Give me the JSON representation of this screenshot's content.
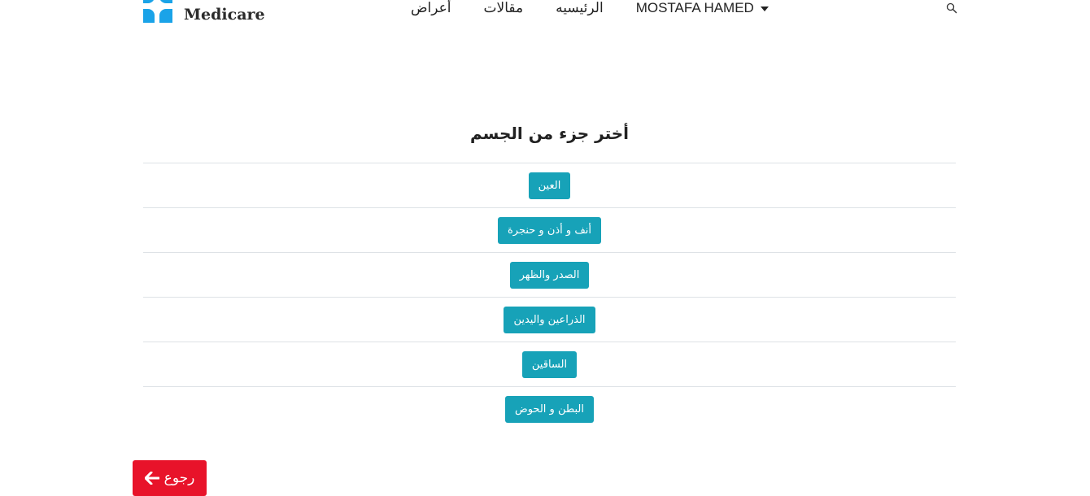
{
  "header": {
    "brand": "Medicare",
    "nav": [
      {
        "label": "أعراض"
      },
      {
        "label": "مقالات"
      },
      {
        "label": "الرئيسيه"
      },
      {
        "label": "MOSTAFA HAMED"
      }
    ],
    "search_icon": "search-icon",
    "dropdown_icon": "caret-down-icon"
  },
  "main": {
    "title": "أختر جزء من الجسم",
    "body_parts": [
      {
        "label": "العين"
      },
      {
        "label": "أنف و أذن و حنجرة"
      },
      {
        "label": "الصدر والظهر"
      },
      {
        "label": "الذراعين واليدين"
      },
      {
        "label": "الساقين"
      },
      {
        "label": "البطن و الحوض"
      }
    ]
  },
  "back_button": {
    "label": "رجوع",
    "icon": "arrow-left-icon"
  },
  "colors": {
    "primary_button": "#17a2b8",
    "back_button": "#e8132a",
    "logo": "#1aa3e8"
  }
}
